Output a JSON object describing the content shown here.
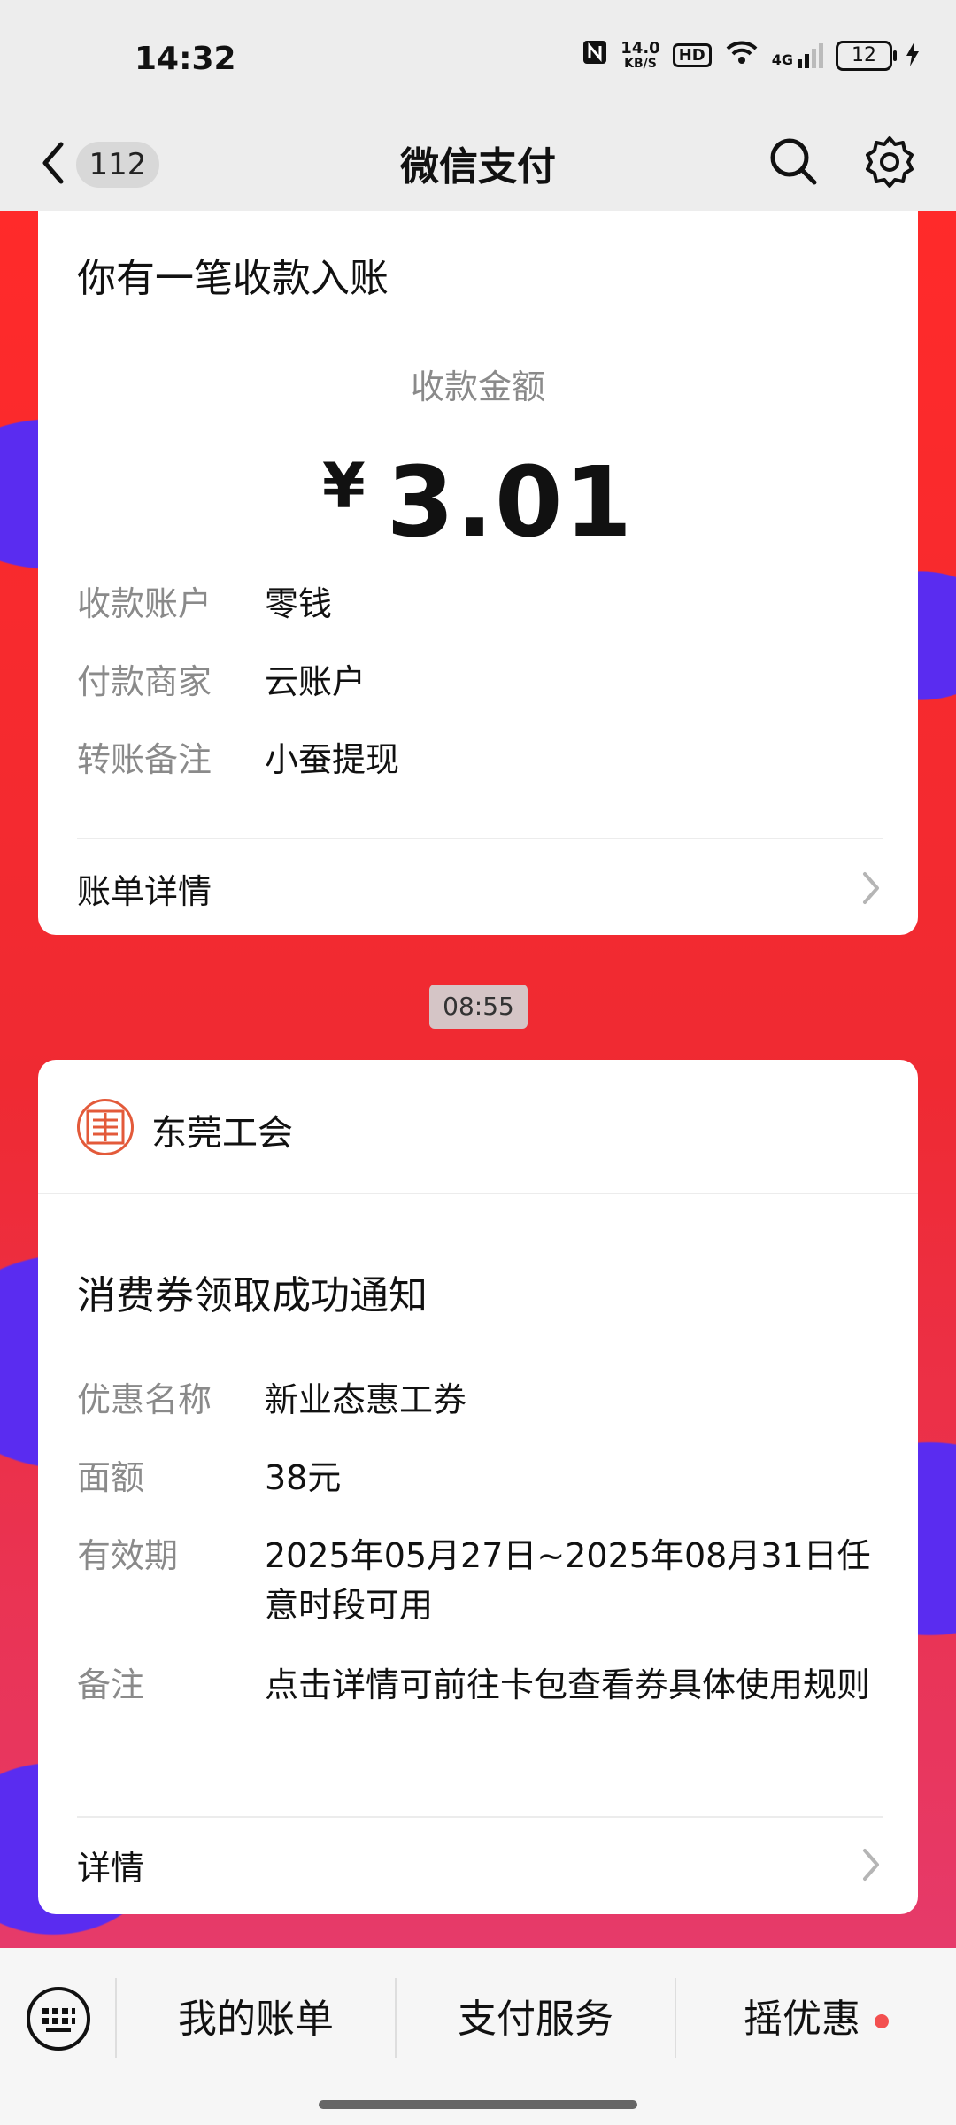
{
  "status_bar": {
    "time": "14:32",
    "speed_value": "14.0",
    "speed_unit": "KB/S",
    "hd_label": "HD",
    "network": "4G",
    "battery": "12"
  },
  "nav": {
    "unread_count": "112",
    "title": "微信支付"
  },
  "payment_card": {
    "heading": "你有一笔收款入账",
    "amount_label": "收款金额",
    "currency": "¥",
    "amount": "3.01",
    "rows": [
      {
        "key": "收款账户",
        "value": "零钱"
      },
      {
        "key": "付款商家",
        "value": "云账户"
      },
      {
        "key": "转账备注",
        "value": "小蚕提现"
      }
    ],
    "footer_label": "账单详情"
  },
  "timestamp": "08:55",
  "coupon_card": {
    "org_name": "东莞工会",
    "heading": "消费券领取成功通知",
    "rows": [
      {
        "key": "优惠名称",
        "value": "新业态惠工券"
      },
      {
        "key": "面额",
        "value": "38元"
      },
      {
        "key": "有效期",
        "value": "2025年05月27日~2025年08月31日任意时段可用"
      },
      {
        "key": "备注",
        "value": "点击详情可前往卡包查看券具体使用规则"
      }
    ],
    "footer_label": "详情"
  },
  "bottom_menu": {
    "items": [
      "我的账单",
      "支付服务",
      "摇优惠"
    ]
  },
  "colors": {
    "accent_dot": "#f35050",
    "wallpaper_red": "#ef2a32",
    "wallpaper_purple": "#5a2cf0"
  }
}
